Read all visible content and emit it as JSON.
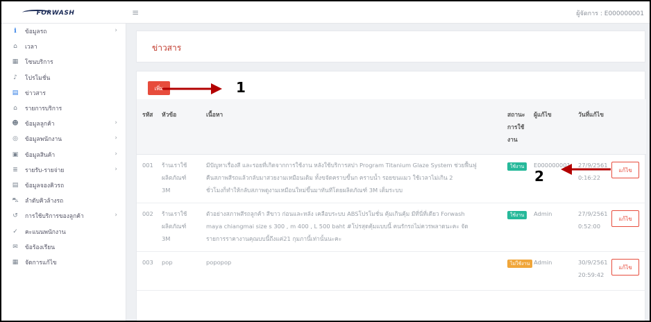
{
  "topbar": {
    "logo_text": "FORWASH",
    "user_label": "ผู้จัดการ : E000000001"
  },
  "sidebar": {
    "items": [
      {
        "label": "ข้อมูลรถ",
        "icon": "info-icon",
        "has_children": true
      },
      {
        "label": "เวลา",
        "icon": "bank-icon",
        "has_children": false
      },
      {
        "label": "โซนบริการ",
        "icon": "grid-icon",
        "has_children": false
      },
      {
        "label": "โปรโมชั่น",
        "icon": "megaphone-icon",
        "has_children": false
      },
      {
        "label": "ข่าวสาร",
        "icon": "newspaper-icon",
        "has_children": false
      },
      {
        "label": "รายการบริการ",
        "icon": "bank-icon",
        "has_children": false
      },
      {
        "label": "ข้อมูลลูกค้า",
        "icon": "users-icon",
        "has_children": true
      },
      {
        "label": "ข้อมูลพนักงาน",
        "icon": "user-circle-icon",
        "has_children": true
      },
      {
        "label": "ข้อมูลสินค้า",
        "icon": "box-icon",
        "has_children": true
      },
      {
        "label": "รายรับ-รายจ่าย",
        "icon": "money-icon",
        "has_children": true
      },
      {
        "label": "ข้อมูลจองคิวรถ",
        "icon": "list-icon",
        "has_children": false
      },
      {
        "label": "ลำดับคิวล้างรถ",
        "icon": "car-icon",
        "has_children": false
      },
      {
        "label": "การใช้บริการของลูกค้า",
        "icon": "history-icon",
        "has_children": true
      },
      {
        "label": "คะแนนพนักงาน",
        "icon": "thumbs-up-icon",
        "has_children": false
      },
      {
        "label": "ข้อร้องเรียน",
        "icon": "complaint-icon",
        "has_children": false
      },
      {
        "label": "จัดการแก้ไข",
        "icon": "table-icon",
        "has_children": false
      }
    ]
  },
  "page": {
    "title": "ข่าวสาร",
    "add_label": "เพิ่ม"
  },
  "table": {
    "headers": {
      "id": "รหัส",
      "topic": "หัวข้อ",
      "content": "เนื้อหา",
      "status": [
        "สถานะ",
        "การใช้",
        "งาน"
      ],
      "editor": "ผู้แก้ไข",
      "date": "วันที่แก้ไข"
    },
    "rows": [
      {
        "id": "001",
        "topic": [
          "ร้านเราใช้",
          "ผลิตภัณฑ์",
          "3M"
        ],
        "content": [
          "มีปัญหาเรื่องสี และรอยที่เกิดจากการใช้งาน หลังใช้บริการสปา Program Titanium Glaze System ช่วยฟื้นฟู",
          "คืนสภาพสีรถแล้วกลับมาสวยงามเหมือนเดิม ทั้งขจัดคราบขี้นก คราบน้ำ รอยขนแมว ใช้เวลาไม่เกิน 2",
          "ชั่วโมงก็ทำให้กลับสภาพดูงามเหมือนใหม่ขึ้นมาทันทีโดยผลิตภัณฑ์ 3M เต็มระบบ"
        ],
        "status": "ใช้งาน",
        "status_color": "#26b99a",
        "editor": "E000000001",
        "date": [
          "27/9/2561",
          "0:16:22"
        ],
        "edit_label": "แก้ไข"
      },
      {
        "id": "002",
        "topic": [
          "ร้านเราใช้",
          "ผลิตภัณฑ์",
          "3M"
        ],
        "content": [
          "ตัวอย่างสภาพสีรถลูกค้า สีขาว ก่อนและหลัง เคลือบระบบ ABSโปรโมชั่น คุ้มเกินคุ้ม มีที่นี่ที่เดียว Forwash",
          "maya chiangmai size s 300 , m 400 , L 500 baht #โปรสุดคุ้มแบบนี้ คนรักรถไม่ควรพลาดนะคะ จัด",
          "รายการราคางานคุณบบนี้ถึงแค่21 กุมภานี้เท่านั้นนะคะ"
        ],
        "status": "ใช้งาน",
        "status_color": "#26b99a",
        "editor": "Admin",
        "date": [
          "27/9/2561",
          "0:52:00"
        ],
        "edit_label": "แก้ไข"
      },
      {
        "id": "003",
        "topic": [
          "pop"
        ],
        "content": [
          "popopop"
        ],
        "status": "ไม่ใช้งาน",
        "status_color": "#f0a63a",
        "editor": "Admin",
        "date": [
          "30/9/2561",
          "20:59:42"
        ],
        "edit_label": "แก้ไข"
      }
    ]
  },
  "annotations": {
    "label_1": "1",
    "label_2": "2",
    "arrow_color": "#b30000"
  }
}
